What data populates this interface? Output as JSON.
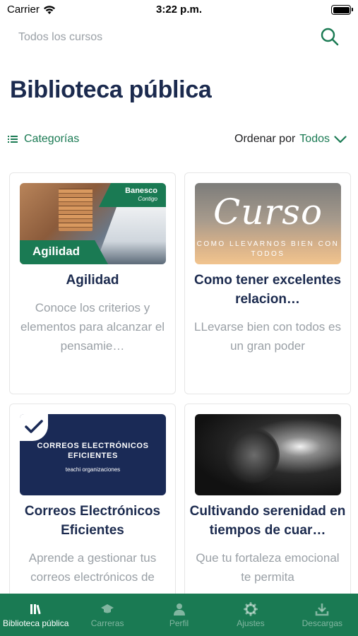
{
  "status_bar": {
    "carrier": "Carrier",
    "time": "3:22 p.m."
  },
  "search": {
    "placeholder": "Todos los cursos"
  },
  "page": {
    "title": "Biblioteca pública"
  },
  "filters": {
    "categories_label": "Categorías",
    "sort_label": "Ordenar por",
    "sort_value": "Todos"
  },
  "courses": [
    {
      "title": "Agilidad",
      "description": "Conoce los criterios y elementos para alcanzar el pensamie…",
      "thumb_label": "Agilidad",
      "thumb_brand": "Banesco",
      "thumb_brand_sub": "Contigo"
    },
    {
      "title": "Como tener excelentes relacion…",
      "description": "LLevarse bien con todos es un gran poder",
      "thumb_word": "Curso",
      "thumb_sub": "COMO LLEVARNOS BIEN CON TODOS"
    },
    {
      "title": "Correos Electrónicos Eficientes",
      "description": "Aprende a gestionar tus correos electrónicos de",
      "thumb_title": "CORREOS ELECTRÓNICOS EFICIENTES",
      "thumb_brand": "teachi organizaciones",
      "completed": true
    },
    {
      "title": "Cultivando serenidad en tiempos de cuar…",
      "description": "Que tu fortaleza emocional te permita"
    }
  ],
  "tabs": [
    {
      "label": "Biblioteca pública",
      "icon": "library-icon",
      "active": true
    },
    {
      "label": "Carreras",
      "icon": "graduation-cap-icon",
      "active": false
    },
    {
      "label": "Perfil",
      "icon": "user-icon",
      "active": false
    },
    {
      "label": "Ajustes",
      "icon": "gear-icon",
      "active": false
    },
    {
      "label": "Descargas",
      "icon": "download-icon",
      "active": false
    }
  ],
  "colors": {
    "primary": "#1a7a53",
    "title": "#1b2a4e",
    "muted": "#9aa0a6"
  }
}
